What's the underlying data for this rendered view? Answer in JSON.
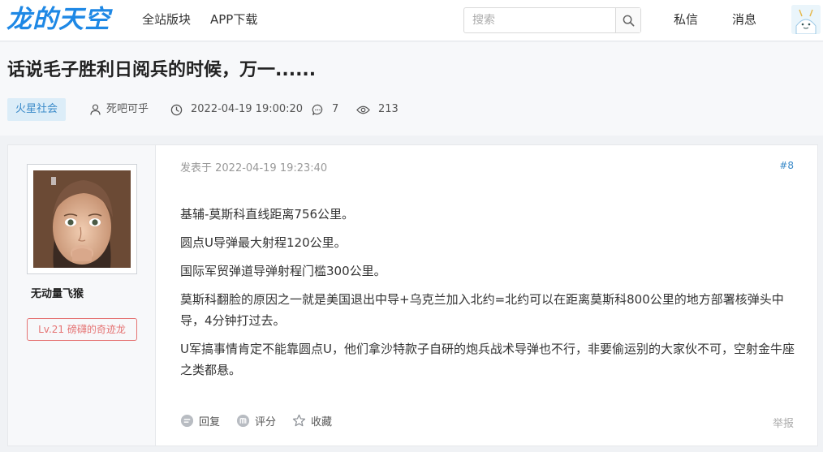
{
  "header": {
    "logo": "龙的天空",
    "nav": [
      "全站版块",
      "APP下载"
    ],
    "search_placeholder": "搜索",
    "messages": "私信",
    "notifications": "消息"
  },
  "thread": {
    "title": "话说毛子胜利日阅兵的时候，万一......",
    "category": "火星社会",
    "author": "死吧可乎",
    "time": "2022-04-19 19:00:20",
    "comments": "7",
    "views": "213"
  },
  "post": {
    "author_name": "无动量飞猴",
    "level": "Lv.21 磅礴的奇迹龙",
    "posted_at": "发表于 2022-04-19 19:23:40",
    "floor": "#8",
    "paragraphs": [
      "基辅-莫斯科直线距离756公里。",
      "圆点U导弹最大射程120公里。",
      "国际军贸弹道导弹射程门槛300公里。",
      "莫斯科翻脸的原因之一就是美国退出中导+乌克兰加入北约=北约可以在距离莫斯科800公里的地方部署核弹头中导，4分钟打过去。",
      "U军搞事情肯定不能靠圆点U，他们拿沙特款子自研的炮兵战术导弹也不行，非要偷运别的大家伙不可，空射金牛座之类都悬。"
    ],
    "actions": {
      "reply": "回复",
      "rate": "评分",
      "favorite": "收藏",
      "report": "举报"
    }
  },
  "colors": {
    "accent": "#1e88e5",
    "tag_bg": "#dcedf8",
    "badge": "#e57373"
  },
  "icons": [
    "search-icon",
    "user-icon",
    "clock-icon",
    "comment-icon",
    "eye-icon",
    "reply-icon",
    "rate-icon",
    "star-icon"
  ]
}
